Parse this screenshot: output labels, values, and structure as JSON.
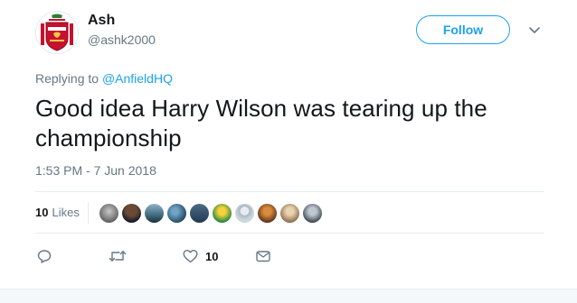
{
  "author": {
    "name": "Ash",
    "handle": "@ashk2000",
    "avatar_icon": "liverpool-crest-icon"
  },
  "follow_button": {
    "label": "Follow"
  },
  "reply": {
    "prefix": "Replying to ",
    "target": "@AnfieldHQ"
  },
  "tweet": {
    "text": "Good idea Harry Wilson was tearing up the championship",
    "timestamp": "1:53 PM - 7 Jun 2018"
  },
  "stats": {
    "likes_number": "10",
    "likes_label": "Likes",
    "liker_count": 10
  },
  "actions": {
    "like_count": "10"
  },
  "colors": {
    "accent": "#1da1f2",
    "muted": "#657786",
    "text": "#14171a",
    "divider": "#e6ecf0",
    "crest_red": "#c8102e"
  }
}
